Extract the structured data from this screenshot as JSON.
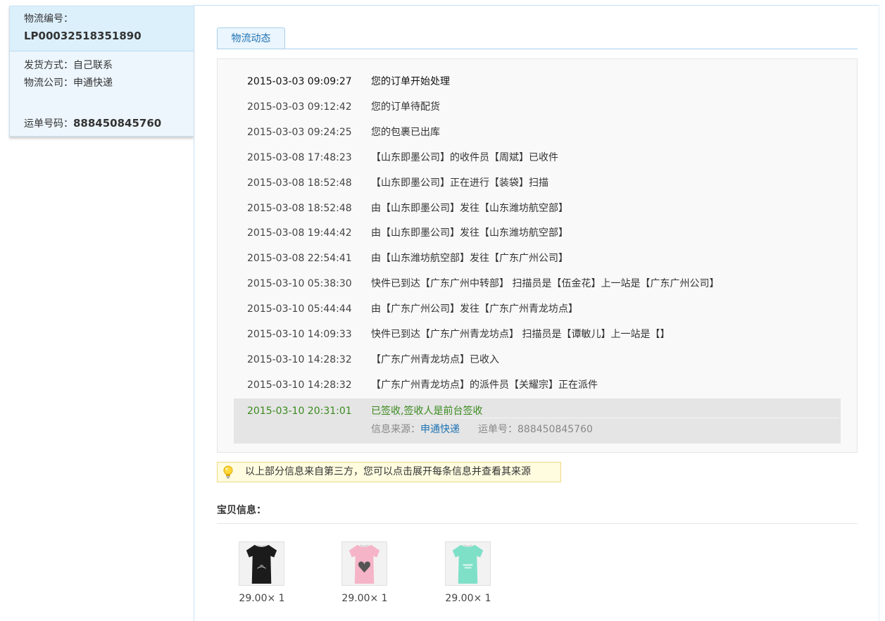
{
  "logistics": {
    "number_label": "物流编号：",
    "number_value": "LP00032518351890",
    "shipping_method": "发货方式：自己联系",
    "company": "物流公司：申通快递",
    "waybill_label": "运单号码：",
    "waybill_value": "888450845760"
  },
  "tab": {
    "label": "物流动态"
  },
  "timeline": [
    {
      "time": "2015-03-03 09:09:27",
      "text": "您的订单开始处理"
    },
    {
      "time": "2015-03-03 09:12:42",
      "text": "您的订单待配货"
    },
    {
      "time": "2015-03-03 09:24:25",
      "text": "您的包裹已出库"
    },
    {
      "time": "2015-03-08 17:48:23",
      "text": "【山东即墨公司】的收件员【周斌】已收件"
    },
    {
      "time": "2015-03-08 18:52:48",
      "text": "【山东即墨公司】正在进行【装袋】扫描"
    },
    {
      "time": "2015-03-08 18:52:48",
      "text": "由【山东即墨公司】发往【山东潍坊航空部】"
    },
    {
      "time": "2015-03-08 19:44:42",
      "text": "由【山东即墨公司】发往【山东潍坊航空部】"
    },
    {
      "time": "2015-03-08 22:54:41",
      "text": "由【山东潍坊航空部】发往【广东广州公司】"
    },
    {
      "time": "2015-03-10 05:38:30",
      "text": "快件已到达【广东广州中转部】 扫描员是【伍金花】上一站是【广东广州公司】"
    },
    {
      "time": "2015-03-10 05:44:44",
      "text": "由【广东广州公司】发往【广东广州青龙坊点】"
    },
    {
      "time": "2015-03-10 14:09:33",
      "text": "快件已到达【广东广州青龙坊点】 扫描员是【谭敏儿】上一站是【】"
    },
    {
      "time": "2015-03-10 14:28:32",
      "text": "【广东广州青龙坊点】已收入"
    },
    {
      "time": "2015-03-10 14:28:32",
      "text": "【广东广州青龙坊点】的派件员【关耀宗】正在派件"
    }
  ],
  "latest": {
    "time": "2015-03-10 20:31:01",
    "text": "已签收,签收人是前台签收",
    "source_label": "信息来源：",
    "source_value": "申通快递",
    "waybill_label": "运单号：",
    "waybill_value": "888450845760"
  },
  "notice": {
    "text": "以上部分信息来自第三方，您可以点击展开每条信息并查看其来源",
    "icon": "lightbulb-icon"
  },
  "items": {
    "title": "宝贝信息：",
    "list": [
      {
        "price": "29.00× 1",
        "shirt_color": "#1b1b1b",
        "print": "heart-script"
      },
      {
        "price": "29.00× 1",
        "shirt_color": "#f6b4c8",
        "print": "heart"
      },
      {
        "price": "29.00× 1",
        "shirt_color": "#7fe0c8",
        "print": "text"
      }
    ]
  }
}
